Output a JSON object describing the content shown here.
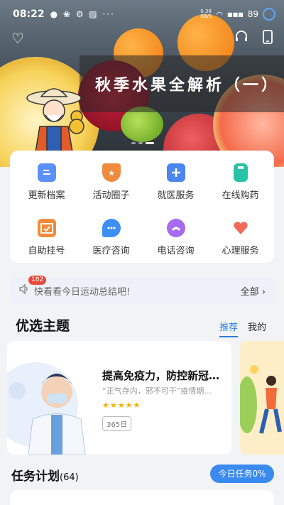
{
  "status_bar": {
    "time": "08:22",
    "indicators": "● ❀ ⚙ ▨ ···",
    "network_speed": "0.38\nKB/S",
    "signal": "■■■",
    "battery": "89"
  },
  "banner": {
    "title": "秋季水果全解析（一）"
  },
  "services": [
    {
      "label": "更新档案",
      "color": "#5b8ff9"
    },
    {
      "label": "活动圈子",
      "color": "#f08a3c"
    },
    {
      "label": "就医服务",
      "color": "#4c86f2"
    },
    {
      "label": "在线购药",
      "color": "#27c3a8"
    },
    {
      "label": "自助挂号",
      "color": "#f08a3c"
    },
    {
      "label": "医疗咨询",
      "color": "#3d8ff5"
    },
    {
      "label": "电话咨询",
      "color": "#a56cf0"
    },
    {
      "label": "心理服务",
      "color": "#f06a5c"
    }
  ],
  "notice": {
    "badge": "182",
    "text": "快看看今日运动总结吧!",
    "all_label": "全部"
  },
  "topics": {
    "title": "优选主题",
    "tabs": [
      "推荐",
      "我的"
    ],
    "card": {
      "title": "提高免疫力，防控新冠…",
      "subtitle": "“正气存内，邪不可干”疫情期…",
      "stars": "★★★★★",
      "tag": "365日"
    }
  },
  "tasks": {
    "title": "任务计划",
    "count": "(64)",
    "button": "今日任务0%"
  },
  "colors": {
    "accent": "#2f7de1",
    "button": "#3a8af0"
  }
}
